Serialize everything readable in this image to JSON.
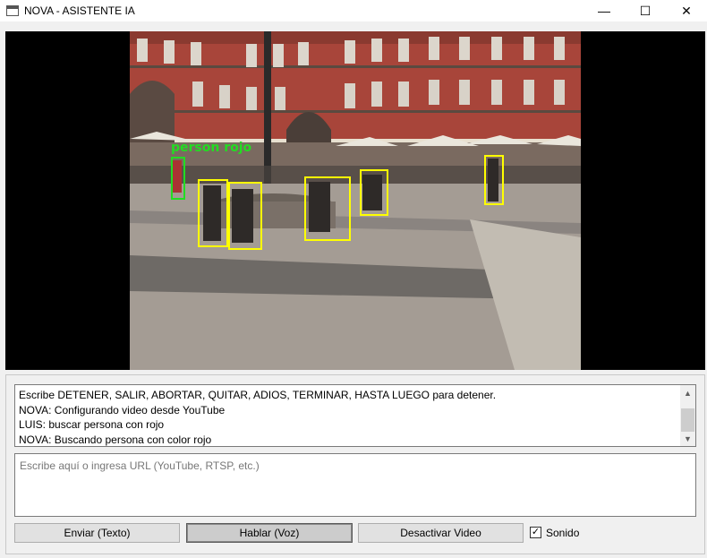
{
  "window": {
    "title": "NOVA - ASISTENTE IA",
    "controls": {
      "minimize": "—",
      "maximize": "☐",
      "close": "✕"
    }
  },
  "video": {
    "detections": [
      {
        "label": "person rojo",
        "color": "#22dd22"
      }
    ]
  },
  "chat": {
    "lines": [
      "Escribe DETENER, SALIR, ABORTAR, QUITAR, ADIOS, TERMINAR, HASTA LUEGO para detener.",
      "NOVA: Configurando video desde YouTube",
      "LUIS: buscar persona con rojo",
      "NOVA: Buscando persona con color rojo"
    ],
    "scroll_up": "▲",
    "scroll_down": "▼"
  },
  "input": {
    "placeholder": "Escribe aquí o ingresa URL (YouTube, RTSP, etc.)",
    "value": ""
  },
  "buttons": {
    "send": "Enviar (Texto)",
    "speak": "Hablar (Voz)",
    "video_toggle": "Desactivar Video"
  },
  "sound": {
    "label": "Sonido",
    "checked": true,
    "check_glyph": "✓"
  }
}
